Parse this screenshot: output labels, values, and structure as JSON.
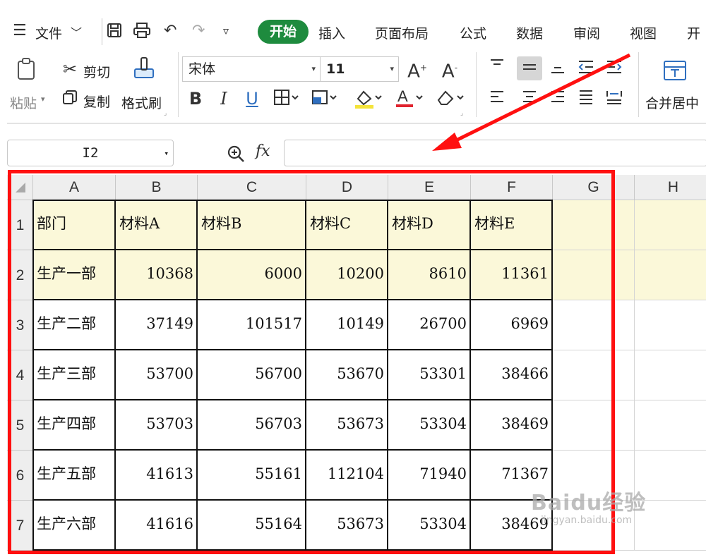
{
  "menu": {
    "file_label": "文件",
    "tabs": [
      "开始",
      "插入",
      "页面布局",
      "公式",
      "数据",
      "审阅",
      "视图",
      "开"
    ]
  },
  "ribbon": {
    "paste_label": "粘贴",
    "cut_label": "剪切",
    "copy_label": "复制",
    "format_painter_label": "格式刷",
    "font_name": "宋体",
    "font_size": "11",
    "merge_label": "合并居中"
  },
  "formula_bar": {
    "name_box": "I2",
    "fx_label": "fx",
    "formula": ""
  },
  "sheet": {
    "columns": [
      "A",
      "B",
      "C",
      "D",
      "E",
      "F",
      "G",
      "H"
    ],
    "row_numbers": [
      "1",
      "2",
      "3",
      "4",
      "5",
      "6",
      "7"
    ],
    "header": [
      "部门",
      "材料A",
      "材料B",
      "材料C",
      "材料D",
      "材料E"
    ],
    "rows": [
      [
        "生产一部",
        "10368",
        "6000",
        "10200",
        "8610",
        "11361"
      ],
      [
        "生产二部",
        "37149",
        "101517",
        "10149",
        "26700",
        "6969"
      ],
      [
        "生产三部",
        "53700",
        "56700",
        "53670",
        "53301",
        "38466"
      ],
      [
        "生产四部",
        "53703",
        "56703",
        "53673",
        "53304",
        "38469"
      ],
      [
        "生产五部",
        "41613",
        "55161",
        "112104",
        "71940",
        "71367"
      ],
      [
        "生产六部",
        "41616",
        "55164",
        "53673",
        "53304",
        "38469"
      ]
    ]
  },
  "watermark": {
    "brand": "Baidu经验",
    "url": "jingyan.baidu.com"
  },
  "colors": {
    "accent_green": "#1e8b3e",
    "annotation_red": "#ff1010",
    "highlight_yellow": "#fbf8d9"
  }
}
